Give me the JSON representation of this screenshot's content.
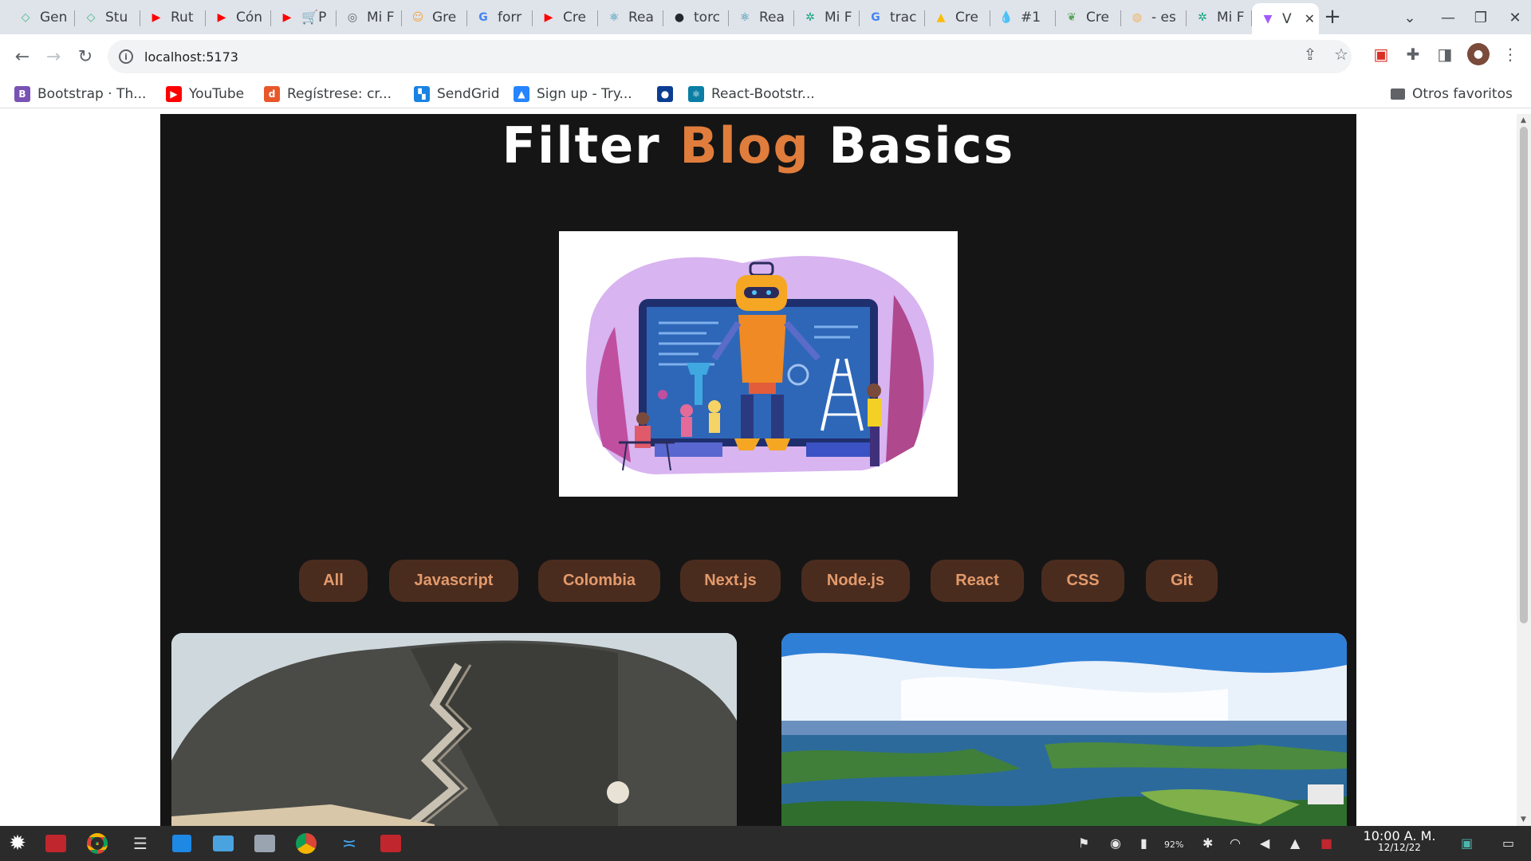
{
  "browser": {
    "tabs": [
      {
        "label": "Gen",
        "favicon": "vue-icon",
        "color": "#41b883",
        "glyph": "◇"
      },
      {
        "label": "Stu",
        "favicon": "vue-icon",
        "color": "#41b883",
        "glyph": "◇"
      },
      {
        "label": "Rut",
        "favicon": "youtube-icon",
        "color": "#ff0000",
        "glyph": "▶"
      },
      {
        "label": "Cón",
        "favicon": "youtube-icon",
        "color": "#ff0000",
        "glyph": "▶"
      },
      {
        "label": "🛒P",
        "favicon": "youtube-icon",
        "color": "#ff0000",
        "glyph": "▶"
      },
      {
        "label": "Mi F",
        "favicon": "globe-icon",
        "color": "#5f6368",
        "glyph": "◎"
      },
      {
        "label": "Gre",
        "favicon": "mask-icon",
        "color": "#f4a340",
        "glyph": "☺"
      },
      {
        "label": "forr",
        "favicon": "google-icon",
        "color": "#4285f4",
        "glyph": "G"
      },
      {
        "label": "Cre",
        "favicon": "youtube-icon",
        "color": "#ff0000",
        "glyph": "▶"
      },
      {
        "label": "Rea",
        "favicon": "react-icon",
        "color": "#0a7ea4",
        "glyph": "⚛"
      },
      {
        "label": "torc",
        "favicon": "github-icon",
        "color": "#24292f",
        "glyph": "●"
      },
      {
        "label": "Rea",
        "favicon": "react-icon",
        "color": "#0a7ea4",
        "glyph": "⚛"
      },
      {
        "label": "Mi F",
        "favicon": "chatgpt-icon",
        "color": "#10a37f",
        "glyph": "✲"
      },
      {
        "label": "trac",
        "favicon": "google-icon",
        "color": "#4285f4",
        "glyph": "G"
      },
      {
        "label": "Cre",
        "favicon": "drive-icon",
        "color": "#fbbc04",
        "glyph": "▲"
      },
      {
        "label": "#1",
        "favicon": "drop-icon",
        "color": "#1aa3c7",
        "glyph": "💧"
      },
      {
        "label": "Cre",
        "favicon": "leaf-icon",
        "color": "#58a55c",
        "glyph": "❦"
      },
      {
        "label": "- es",
        "favicon": "translate-icon",
        "color": "#f2b35c",
        "glyph": "◍"
      },
      {
        "label": "Mi F",
        "favicon": "chatgpt-icon",
        "color": "#10a37f",
        "glyph": "✲"
      },
      {
        "label": "V",
        "favicon": "vite-icon",
        "color": "#a259ff",
        "glyph": "▼",
        "active": true
      }
    ],
    "new_tab": "+",
    "url": "localhost:5173",
    "bookmarks": [
      {
        "label": "Bootstrap · Th...",
        "favicon": "bootstrap-icon",
        "color": "#7952b3",
        "glyph": "B"
      },
      {
        "label": "YouTube",
        "favicon": "youtube-icon",
        "color": "#ff0000",
        "glyph": "▶"
      },
      {
        "label": "Regístrese: cr...",
        "favicon": "d-icon",
        "color": "#e8572a",
        "glyph": "d"
      },
      {
        "label": "SendGrid",
        "favicon": "sendgrid-icon",
        "color": "#1a82e2",
        "glyph": "▚"
      },
      {
        "label": "Sign up - Try...",
        "favicon": "atlassian-icon",
        "color": "#2684ff",
        "glyph": "▲"
      },
      {
        "label": "",
        "favicon": "nasa-icon",
        "color": "#0b3d91",
        "glyph": "●"
      },
      {
        "label": "React-Bootstr...",
        "favicon": "react-icon",
        "color": "#0a7ea4",
        "glyph": "⚛"
      }
    ],
    "other_bookmarks": "Otros favoritos"
  },
  "page": {
    "title_part1": "Filter ",
    "title_accent": "Blog",
    "title_part2": " Basics",
    "accent_color": "#e07d3c",
    "filters": [
      "All",
      "Javascript",
      "Colombia",
      "Next.js",
      "Node.js",
      "React",
      "CSS",
      "Git"
    ]
  },
  "taskbar": {
    "battery": "92%",
    "time": "10:00 A. M.",
    "date": "12/12/22"
  }
}
